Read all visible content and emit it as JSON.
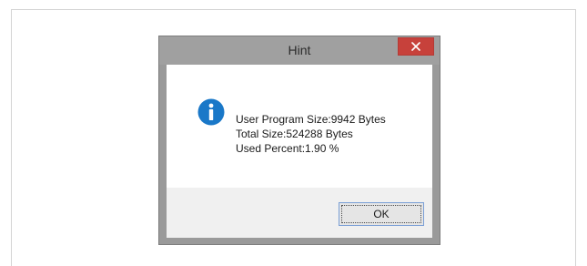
{
  "dialog": {
    "title": "Hint",
    "message_lines": [
      "User Program Size:9942 Bytes",
      "Total Size:524288 Bytes",
      "Used Percent:1.90 %"
    ],
    "ok_label": "OK",
    "icon": "info-icon",
    "close_icon": "close-icon"
  },
  "colors": {
    "title_bar": "#a0a0a0",
    "close_button": "#c7413b",
    "info_icon": "#1a78c8",
    "footer": "#f0f0f0"
  }
}
